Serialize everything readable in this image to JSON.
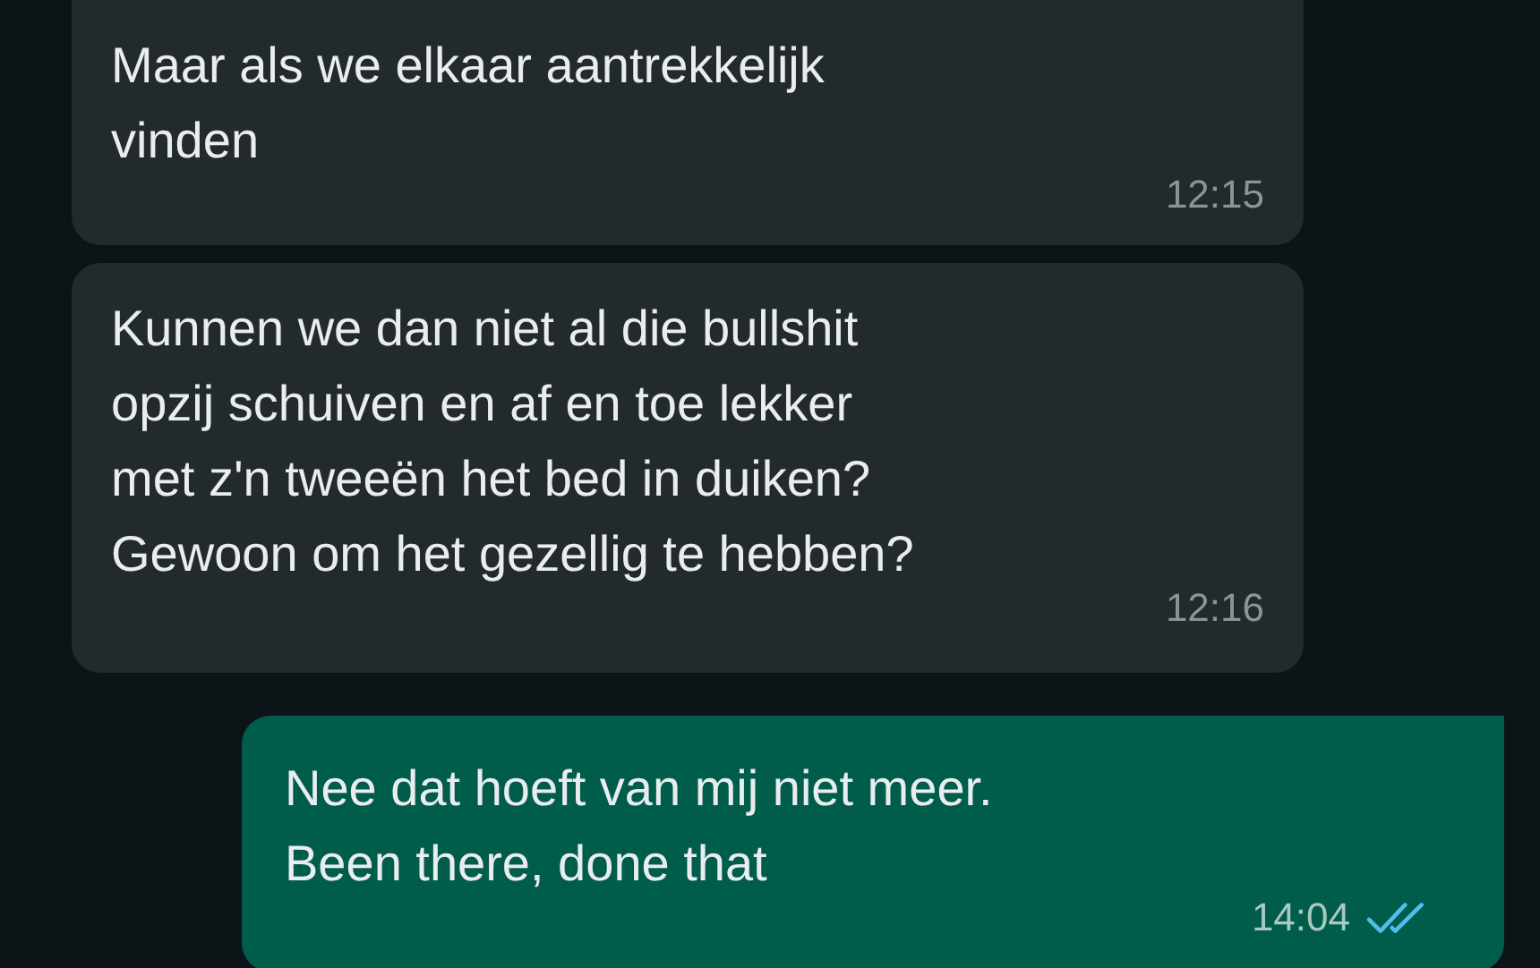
{
  "messages": [
    {
      "kind": "incoming",
      "text": "Maar als we elkaar aantrekkelijk\nvinden",
      "time": "12:15"
    },
    {
      "kind": "incoming",
      "text": "Kunnen we dan niet al die bullshit\nopzij schuiven en af en toe lekker\nmet z'n tweeën het bed in duiken?\nGewoon om het gezellig te hebben?",
      "time": "12:16"
    },
    {
      "kind": "outgoing",
      "text": "Nee dat hoeft van mij niet meer.\nBeen there, done that",
      "time": "14:04",
      "read": true
    }
  ]
}
